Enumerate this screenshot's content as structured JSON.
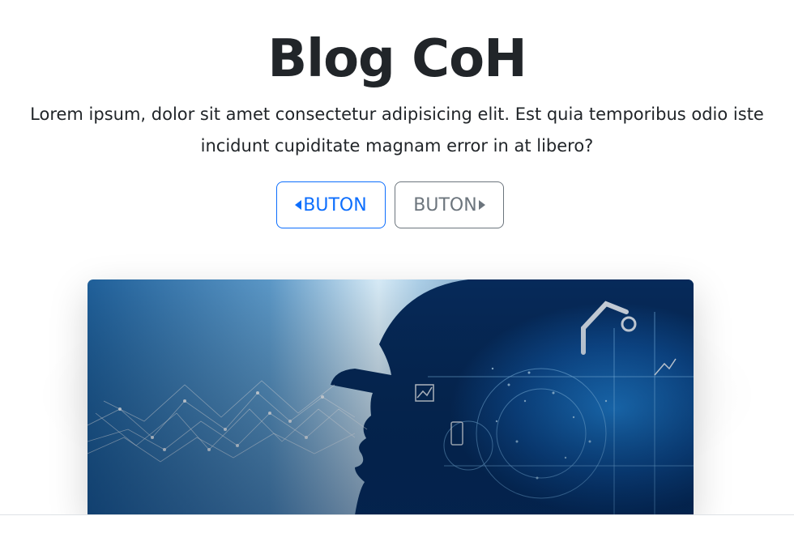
{
  "hero": {
    "title": "Blog CoH",
    "lead": "Lorem ipsum, dolor sit amet consectetur adipisicing elit. Est quia temporibus odio iste incidunt cupiditate magnam error in at libero?",
    "buttons": {
      "prev_label": "BUTON",
      "next_label": "BUTON"
    },
    "image": {
      "description": "",
      "icons": [
        "caret-left-icon",
        "caret-right-icon"
      ]
    }
  },
  "colors": {
    "primary": "#0d6efd",
    "secondary": "#6c757d",
    "text": "#212529",
    "image_dark_blue": "#0b3b73",
    "image_light_blue": "#d8ecf7"
  }
}
